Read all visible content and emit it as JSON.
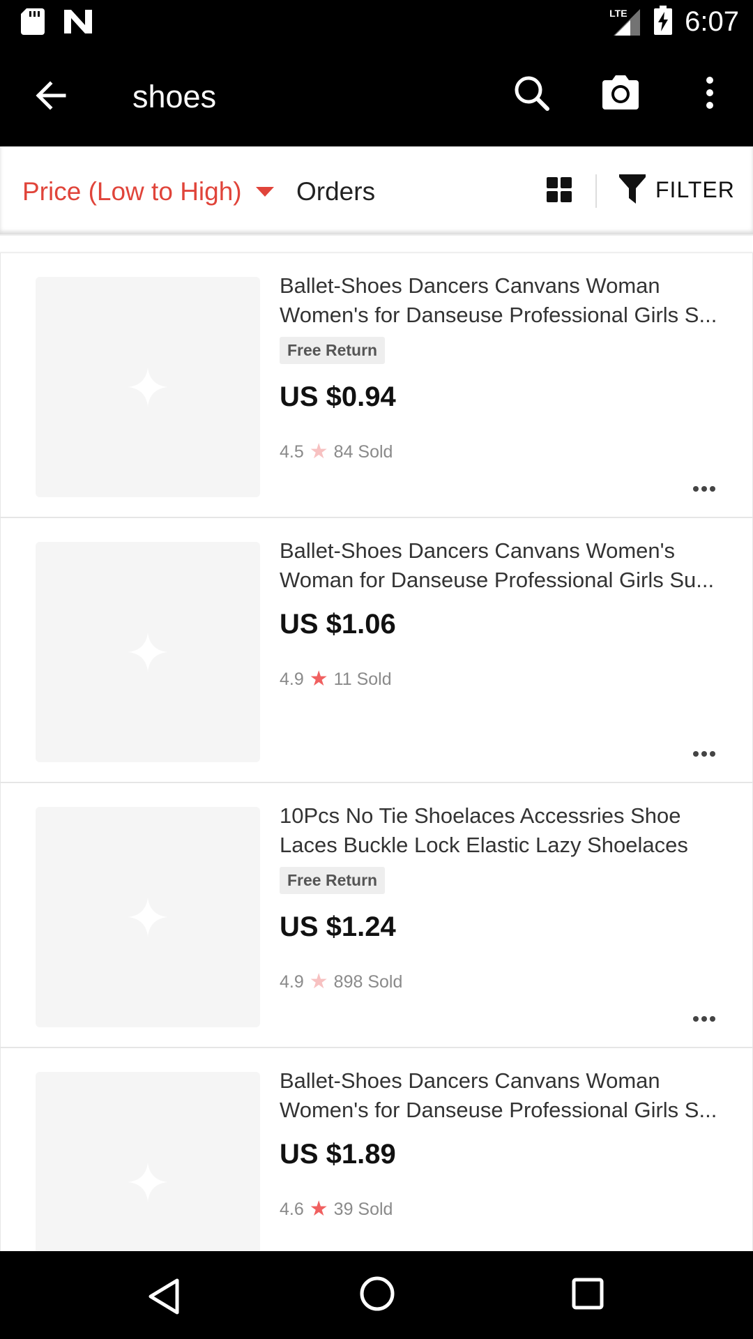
{
  "status_bar": {
    "time": "6:07",
    "network": "LTE",
    "icons": [
      "sd-card-icon",
      "n-logo-icon",
      "signal-icon",
      "battery-charging-icon"
    ]
  },
  "app_bar": {
    "title": "shoes",
    "icons": [
      "back-arrow-icon",
      "search-icon",
      "camera-icon",
      "more-vert-icon"
    ]
  },
  "sort_bar": {
    "price_sort": "Price (Low to High)",
    "orders": "Orders",
    "filter": "FILTER",
    "accent_color": "#e0443a"
  },
  "products": [
    {
      "title_line1": "Ballet-Shoes Dancers Canvans Woman",
      "title_line2": "Women's for Danseuse Professional Girls S...",
      "badge": "Free Return",
      "price": "US $0.94",
      "rating": "4.5",
      "sold": "84 Sold"
    },
    {
      "title_line1": "Ballet-Shoes Dancers Canvans Women's",
      "title_line2": "Woman for Danseuse Professional Girls Su...",
      "badge": "",
      "price": "US $1.06",
      "rating": "4.9",
      "sold": "11 Sold"
    },
    {
      "title_line1": "10Pcs No Tie Shoelaces Accessries Shoe",
      "title_line2": "Laces Buckle Lock Elastic Lazy Shoelaces",
      "badge": "Free Return",
      "price": "US $1.24",
      "rating": "4.9",
      "sold": "898 Sold"
    },
    {
      "title_line1": "Ballet-Shoes Dancers Canvans Woman",
      "title_line2": "Women's for Danseuse Professional Girls S...",
      "badge": "",
      "price": "US $1.89",
      "rating": "4.6",
      "sold": "39 Sold"
    }
  ],
  "nav_bar": {
    "icons": [
      "nav-back-icon",
      "nav-home-icon",
      "nav-recent-icon"
    ]
  }
}
